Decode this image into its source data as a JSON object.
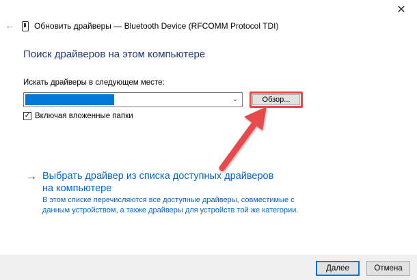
{
  "window": {
    "title": "Обновить драйверы — Bluetooth Device (RFCOMM Protocol TDI)",
    "close_glyph": "✕",
    "back_glyph": "←"
  },
  "search": {
    "heading": "Поиск драйверов на этом компьютере",
    "field_label": "Искать драйверы в следующем месте:",
    "path_value": "",
    "chevron_glyph": "⌄",
    "browse_label": "Обзор...",
    "include_subfolders_label": "Включая вложенные папки",
    "include_subfolders_checked": true,
    "checkbox_glyph": "✓"
  },
  "pick_list": {
    "arrow_glyph": "→",
    "title": "Выбрать драйвер из списка доступных драйверов на компьютере",
    "description": "В этом списке перечисляются все доступные драйверы, совместимые с данным устройством, а также драйверы для устройств той же категории."
  },
  "footer": {
    "next_label": "Далее",
    "cancel_label": "Отмена"
  },
  "colors": {
    "accent": "#0078d7",
    "link": "#0066cc",
    "heading": "#1e3a78",
    "annotation_arrow": "#e8484b"
  },
  "icons": {
    "app": "device-icon",
    "back": "back-arrow-icon",
    "close": "close-icon"
  }
}
